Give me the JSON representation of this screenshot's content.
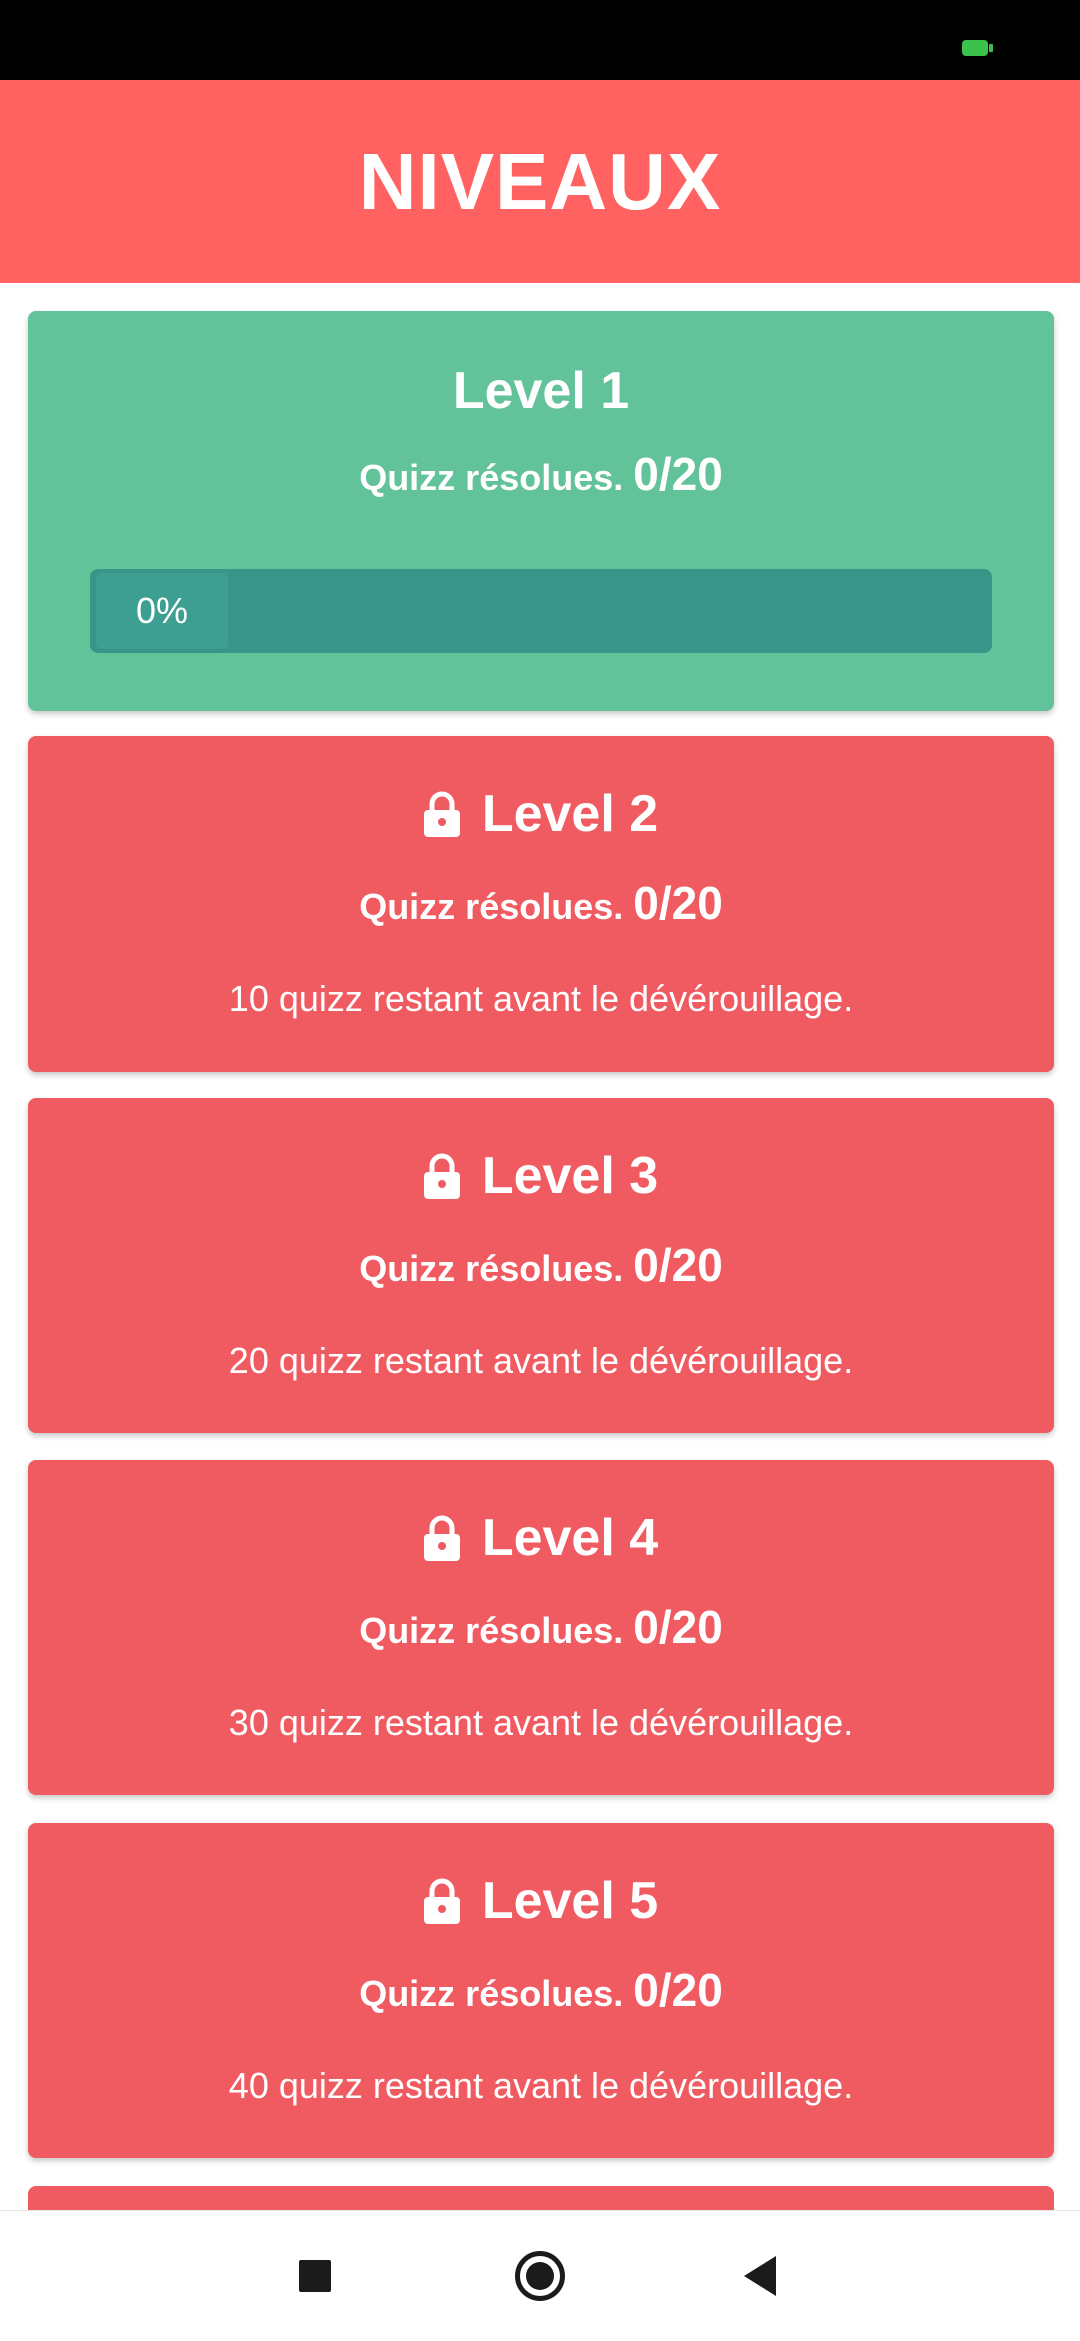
{
  "header": {
    "title": "NIVEAUX"
  },
  "levels": [
    {
      "title": "Level 1",
      "solved_label": "Quizz résolues.",
      "solved_count": "0/20",
      "locked": false,
      "progress_text": "0%",
      "progress_value": 0
    },
    {
      "title": "Level 2",
      "solved_label": "Quizz résolues.",
      "solved_count": "0/20",
      "locked": true,
      "remaining": "10 quizz restant avant le dévérouillage."
    },
    {
      "title": "Level 3",
      "solved_label": "Quizz résolues.",
      "solved_count": "0/20",
      "locked": true,
      "remaining": "20 quizz restant avant le dévérouillage."
    },
    {
      "title": "Level 4",
      "solved_label": "Quizz résolues.",
      "solved_count": "0/20",
      "locked": true,
      "remaining": "30 quizz restant avant le dévérouillage."
    },
    {
      "title": "Level 5",
      "solved_label": "Quizz résolues.",
      "solved_count": "0/20",
      "locked": true,
      "remaining": "40 quizz restant avant le dévérouillage."
    }
  ],
  "icons": {
    "lock": "lock-icon",
    "battery": "battery-icon",
    "recents": "recents-icon",
    "home": "home-icon",
    "back": "back-icon"
  },
  "colors": {
    "header": "#ff6260",
    "unlocked_card": "#62c29a",
    "locked_card": "#f05b62",
    "progress_track": "#379688"
  }
}
